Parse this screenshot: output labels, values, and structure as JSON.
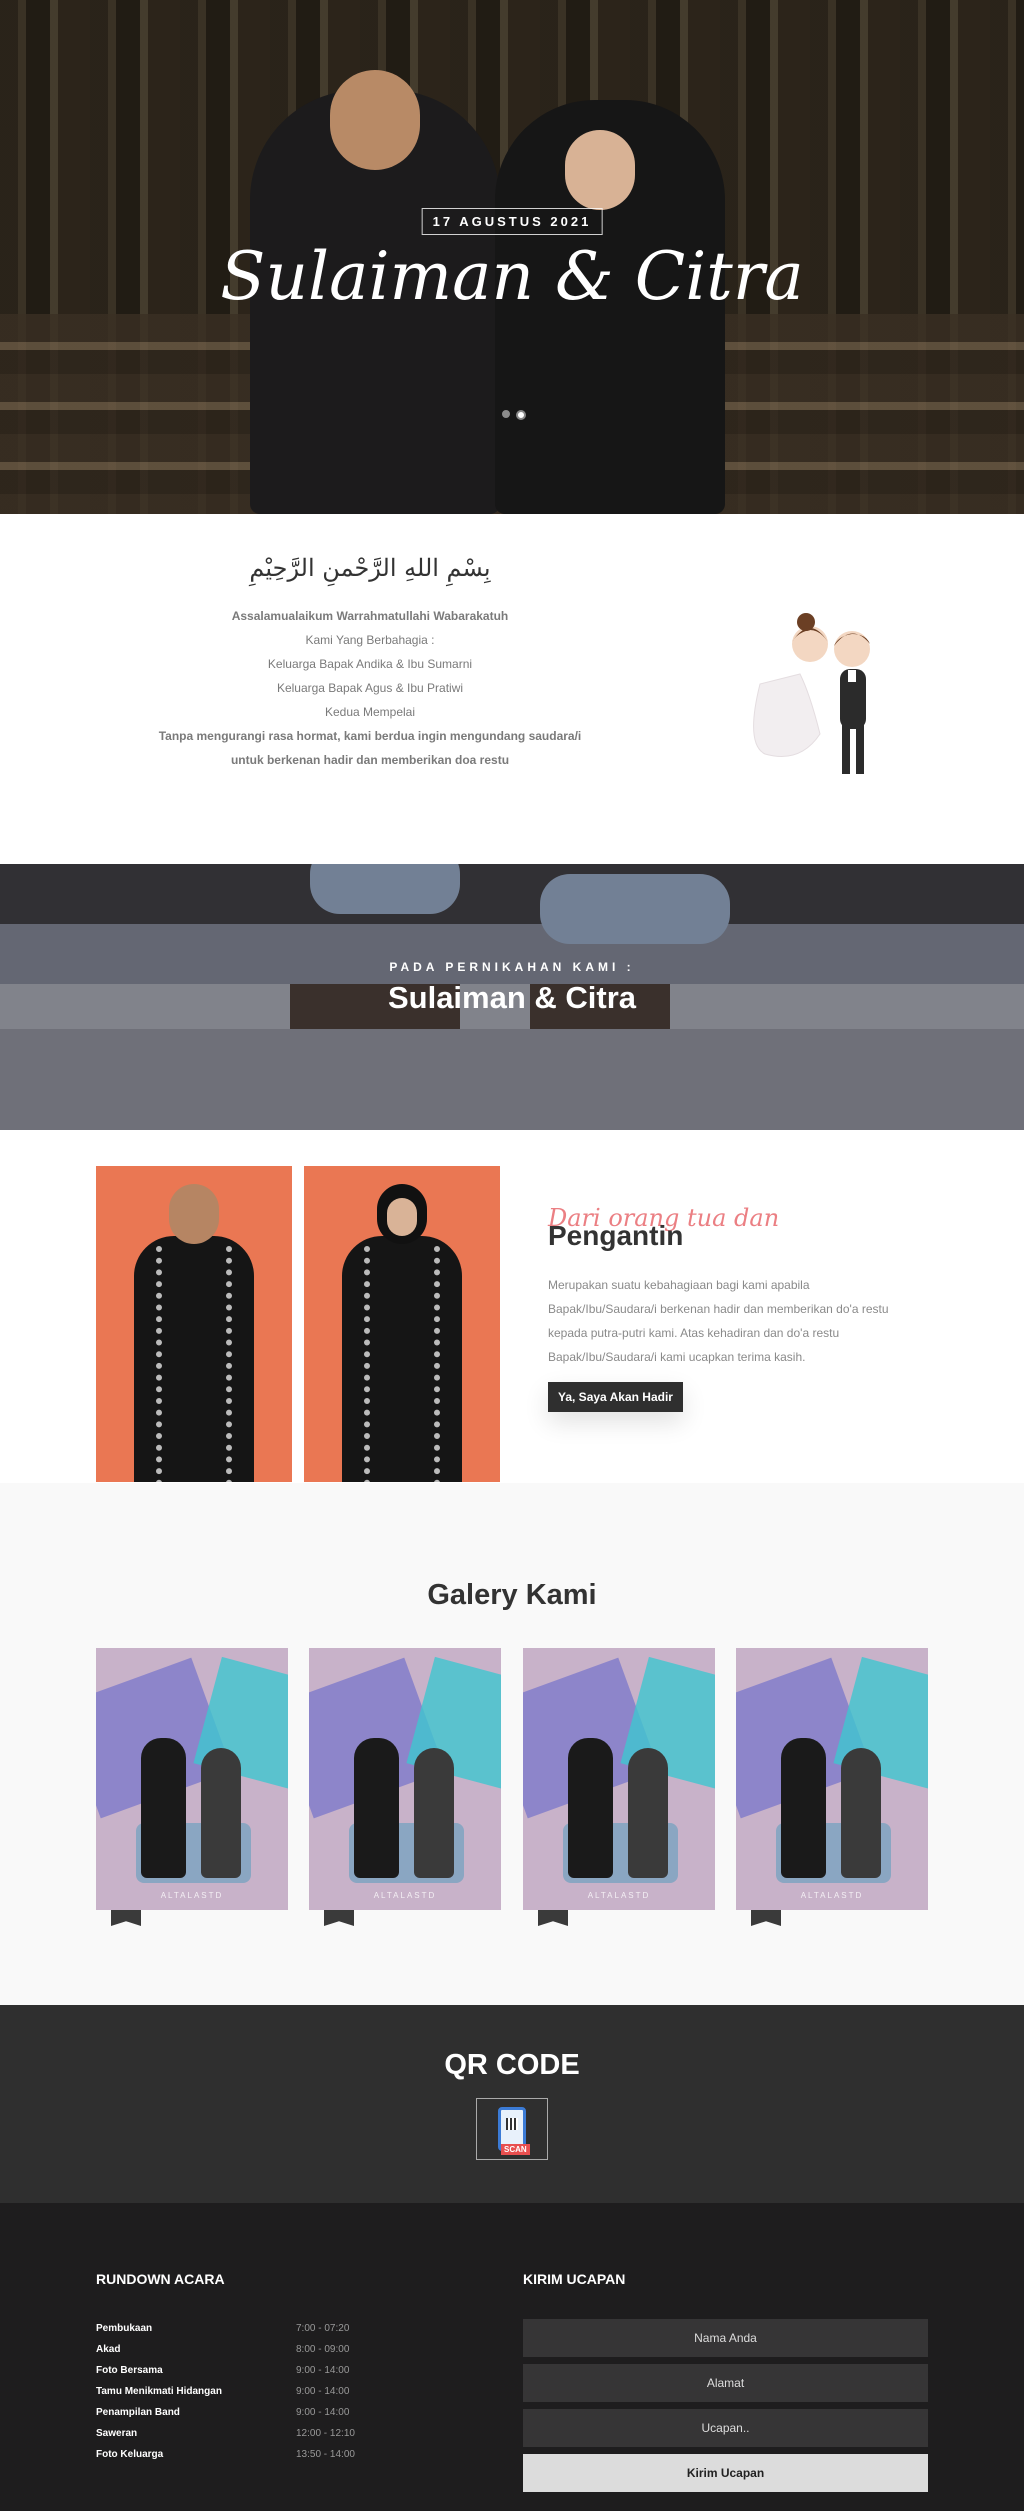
{
  "hero": {
    "date": "17 AGUSTUS 2021",
    "names": "Sulaiman & Citra"
  },
  "intro": {
    "arabic": "بِسْمِ اللهِ الرَّحْمنِ الرَّحِيْمِ",
    "greeting": "Assalamualaikum Warrahmatullahi Wabarakatuh",
    "line1": "Kami Yang Berbahagia :",
    "line2": "Keluarga Bapak Andika & Ibu Sumarni",
    "line3": "Keluarga Bapak Agus & Ibu Pratiwi",
    "line4": "Kedua Mempelai",
    "closing": "Tanpa mengurangi rasa hormat, kami berdua ingin mengundang saudara/i untuk berkenan hadir dan memberikan doa restu"
  },
  "band": {
    "label": "PADA PERNIKAHAN KAMI :",
    "title": "Sulaiman & Citra"
  },
  "couple": {
    "script": "Dari orang tua dan",
    "heading": "Pengantin",
    "description": "Merupakan suatu kebahagiaan bagi kami apabila Bapak/Ibu/Saudara/i berkenan hadir dan memberikan do'a restu kepada putra-putri kami. Atas kehadiran dan do'a restu Bapak/Ibu/Saudara/i kami ucapkan terima kasih.",
    "button": "Ya, Saya Akan Hadir"
  },
  "gallery": {
    "title": "Galery Kami",
    "items": [
      {
        "watermark": "ALTALASTD"
      },
      {
        "watermark": "ALTALASTD"
      },
      {
        "watermark": "ALTALASTD"
      },
      {
        "watermark": "ALTALASTD"
      }
    ]
  },
  "qr": {
    "title": "QR CODE",
    "scan_label": "SCAN"
  },
  "rundown": {
    "title": "RUNDOWN ACARA",
    "items": [
      {
        "event": "Pembukaan",
        "time": "7:00 - 07:20"
      },
      {
        "event": "Akad",
        "time": "8:00 - 09:00"
      },
      {
        "event": "Foto Bersama",
        "time": "9:00 - 14:00"
      },
      {
        "event": "Tamu Menikmati Hidangan",
        "time": "9:00 - 14:00"
      },
      {
        "event": "Penampilan Band",
        "time": "9:00 - 14:00"
      },
      {
        "event": "Saweran",
        "time": "12:00 - 12:10"
      },
      {
        "event": "Foto Keluarga",
        "time": "13:50 - 14:00"
      }
    ]
  },
  "ucapan": {
    "title": "KIRIM UCAPAN",
    "name_placeholder": "Nama Anda",
    "address_placeholder": "Alamat",
    "message_placeholder": "Ucapan..",
    "submit": "Kirim Ucapan"
  }
}
